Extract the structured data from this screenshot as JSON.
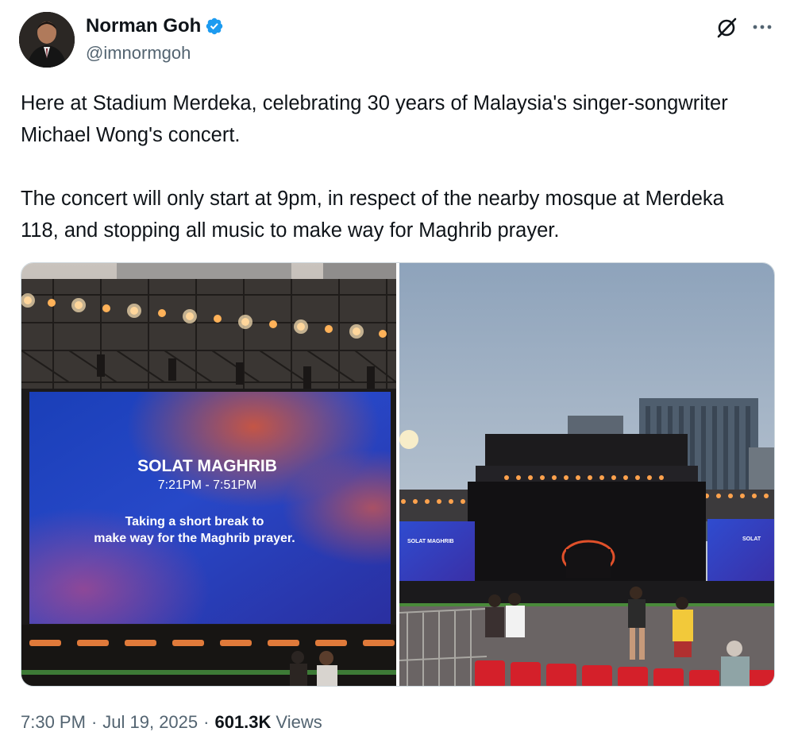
{
  "author": {
    "name": "Norman Goh",
    "handle": "@imnormgoh",
    "verified": true,
    "badge_color": "#1d9bf0"
  },
  "icons": {
    "grok": "grok-icon",
    "more": "more-icon"
  },
  "tweet": {
    "paragraph_1": "Here at Stadium Merdeka, celebrating 30 years of Malaysia's singer-songwriter Michael Wong's concert.",
    "paragraph_2": "The concert will only start at 9pm, in respect of the nearby mosque at Merdeka 118, and stopping all music to make way for Maghrib prayer."
  },
  "media": {
    "left_photo": {
      "screen_title": "SOLAT MAGHRIB",
      "screen_time": "7:21PM - 7:51PM",
      "screen_line_1": "Taking a short break to",
      "screen_line_2": "make way for the Maghrib prayer."
    },
    "right_photo": {
      "small_screen_left": "SOLAT MAGHRIB",
      "small_screen_right": "SOLAT"
    }
  },
  "meta": {
    "time": "7:30 PM",
    "date": "Jul 19, 2025",
    "separator": "·",
    "views_count": "601.3K",
    "views_label": "Views"
  }
}
